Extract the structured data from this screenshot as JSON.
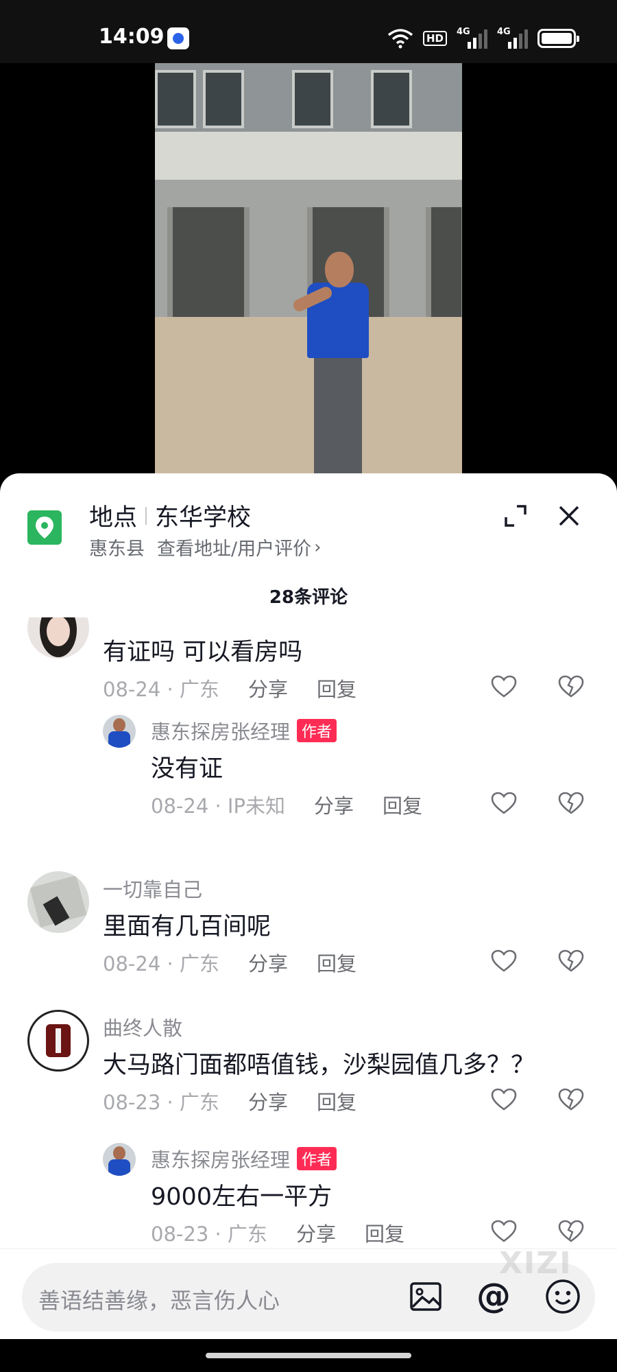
{
  "status_bar": {
    "time": "14:09",
    "app_icon": "baidu-icon",
    "hd_label": "HD",
    "signal_1_label": "4G",
    "signal_2_label": "4G",
    "battery_level": 1.0
  },
  "video": {
    "description_icon": "video-frame"
  },
  "location": {
    "label": "地点",
    "name": "东华学校",
    "county": "惠东县",
    "link": "查看地址/用户评价",
    "chevron": "›",
    "pin_color": "#2bb55e"
  },
  "comments_header": {
    "count_label": "28条评论"
  },
  "comments": [
    {
      "text": "有证吗 可以看房吗",
      "date": "08-24 · 广东",
      "share": "分享",
      "reply": "回复",
      "replies": [
        {
          "author": "惠东探房张经理",
          "tag": "作者",
          "text": "没有证",
          "date": "08-24 · IP未知",
          "share": "分享",
          "reply": "回复"
        }
      ]
    },
    {
      "author": "一切靠自己",
      "text": "里面有几百间呢",
      "date": "08-24 · 广东",
      "share": "分享",
      "reply": "回复"
    },
    {
      "author": "曲终人散",
      "text": "大马路门面都唔值钱，沙梨园值几多？？",
      "date": "08-23 · 广东",
      "share": "分享",
      "reply": "回复",
      "replies": [
        {
          "author": "惠东探房张经理",
          "tag": "作者",
          "text": "9000左右一平方",
          "date": "08-23 · 广东",
          "share": "分享",
          "reply": "回复"
        }
      ]
    }
  ],
  "input": {
    "placeholder": "善语结善缘，恶言伤人心",
    "at_symbol": "@"
  },
  "watermark": "XIZI",
  "colors": {
    "author_tag": "#fe2c55",
    "text": "#161823",
    "muted": "#8a8b91"
  }
}
